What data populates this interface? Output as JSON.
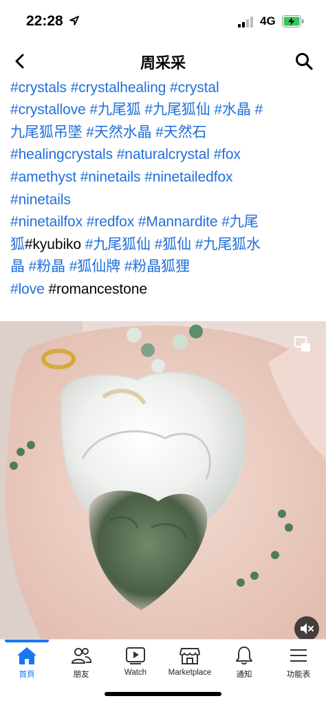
{
  "status_bar": {
    "time": "22:28",
    "network": "4G",
    "icons": [
      "location-arrow-icon",
      "signal-bars-icon",
      "battery-charging-icon"
    ]
  },
  "header": {
    "title": "周采采",
    "back_icon": "chevron-left-icon",
    "search_icon": "search-icon"
  },
  "post": {
    "lines": [
      [
        {
          "text": "#crystals #crystalhealing #crystal",
          "tag": true
        }
      ],
      [
        {
          "text": "#crystallove #九尾狐 #九尾狐仙 #水晶 #",
          "tag": true
        }
      ],
      [
        {
          "text": "九尾狐吊墜 #天然水晶 #天然石",
          "tag": true
        }
      ],
      [
        {
          "text": "#healingcrystals #naturalcrystal #fox",
          "tag": true
        }
      ],
      [
        {
          "text": "#amethyst #ninetails #ninetailedfox",
          "tag": true
        }
      ],
      [
        {
          "text": "#ninetails",
          "tag": true
        }
      ],
      [
        {
          "text": "#ninetailfox #redfox #Mannardite #九尾",
          "tag": true
        }
      ],
      [
        {
          "text": "狐",
          "tag": true
        },
        {
          "text": "#kyubiko ",
          "tag": false
        },
        {
          "text": "#九尾狐仙 #狐仙 #九尾狐水",
          "tag": true
        }
      ],
      [
        {
          "text": "晶 #粉晶 #狐仙牌 #粉晶狐狸",
          "tag": true
        }
      ],
      [
        {
          "text": "#love",
          "tag": true
        },
        {
          "text": " #romancestone",
          "tag": false
        }
      ]
    ]
  },
  "media": {
    "expand_icon": "fullscreen-icon",
    "mute_icon": "speaker-muted-icon"
  },
  "tabs": [
    {
      "label": "首頁",
      "icon": "home-icon",
      "active": true
    },
    {
      "label": "朋友",
      "icon": "friends-icon",
      "active": false
    },
    {
      "label": "Watch",
      "icon": "watch-play-icon",
      "active": false
    },
    {
      "label": "Marketplace",
      "icon": "marketplace-shop-icon",
      "active": false
    },
    {
      "label": "通知",
      "icon": "bell-icon",
      "active": false
    },
    {
      "label": "功能表",
      "icon": "menu-icon",
      "active": false
    }
  ],
  "colors": {
    "accent": "#1877f2",
    "hashtag": "#216fdb",
    "text": "#050505"
  }
}
